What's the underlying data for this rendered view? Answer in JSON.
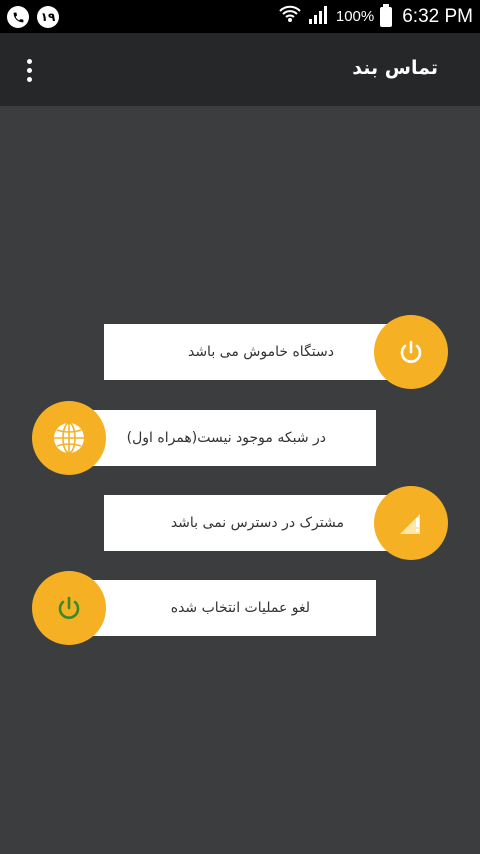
{
  "status_bar": {
    "battery_percent": "100%",
    "time": "6:32 PM",
    "notification_badge": "۱۹"
  },
  "toolbar": {
    "title": "تماس بند",
    "menu_icon": "overflow-menu-icon"
  },
  "options": [
    {
      "label": "دستگاه خاموش می باشد",
      "icon": "power-icon"
    },
    {
      "label": "در شبکه موجود نیست(همراه اول)",
      "icon": "globe-icon"
    },
    {
      "label": "مشترک در دسترس نمی باشد",
      "icon": "no-signal-icon"
    },
    {
      "label": "لغو عملیات انتخاب شده",
      "icon": "power-icon"
    }
  ],
  "colors": {
    "accent": "#f6b024",
    "background": "#3b3d3f",
    "toolbar": "#262729",
    "card": "#ffffff",
    "cancel_icon": "#3a8a2a"
  }
}
